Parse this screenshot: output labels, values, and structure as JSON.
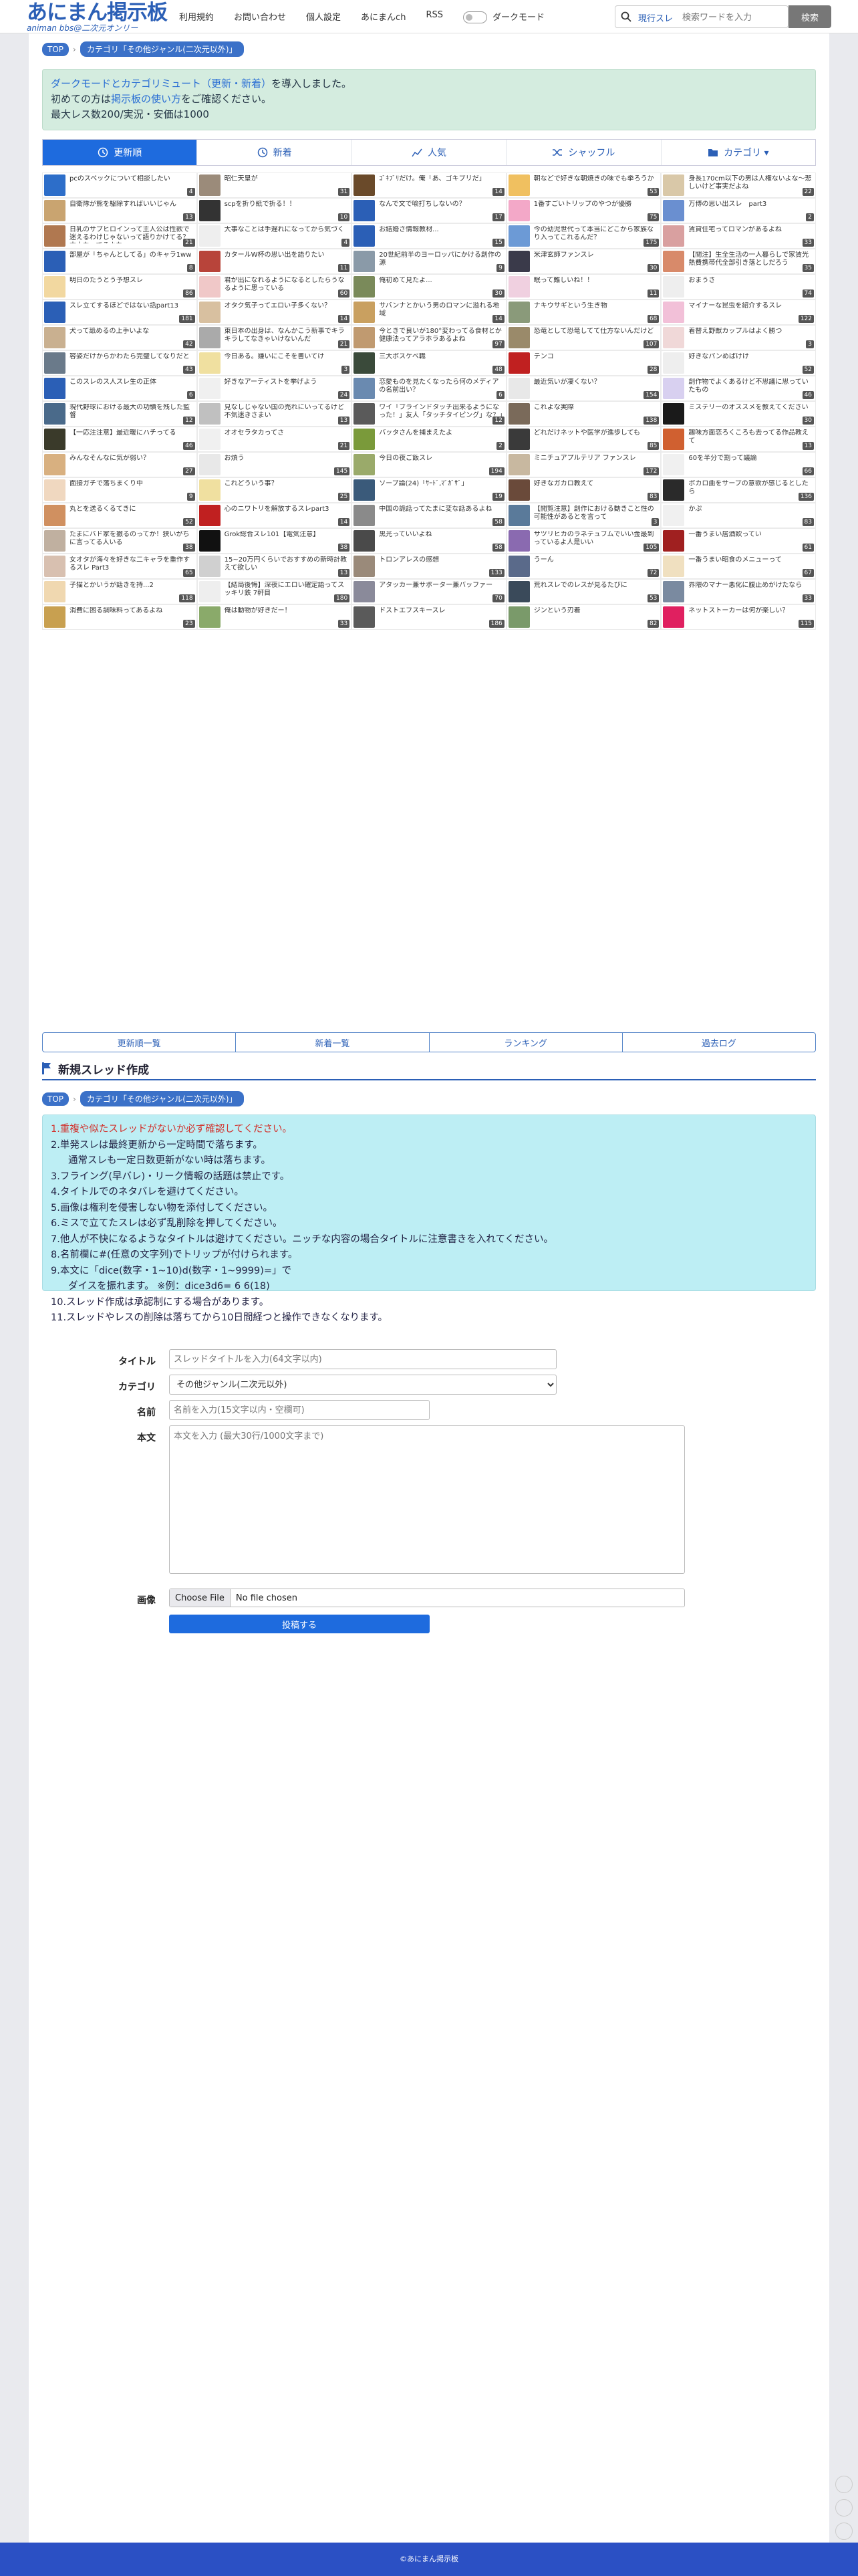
{
  "header": {
    "title": "あにまん掲示板",
    "subtitle": "animan bbs@二次元オンリー",
    "nav": [
      "利用規約",
      "お問い合わせ",
      "個人設定",
      "あにまんch",
      "RSS"
    ],
    "dark_mode_label": "ダークモード",
    "search_scope": "現行スレ",
    "search_placeholder": "検索ワードを入力",
    "search_button": "検索"
  },
  "breadcrumb": {
    "top": "TOP",
    "category": "カテゴリ「その他ジャンル(二次元以外)」"
  },
  "notice": {
    "line1a": "ダークモードとカテゴリミュート（更新・新着）",
    "line1b": "を導入しました。",
    "line2a": "初めての方は",
    "line2b": "掲示板の使い方",
    "line2c": "をご確認ください。",
    "line3": "最大レス数200/実況・安価は1000"
  },
  "tabs": [
    {
      "label": "更新順",
      "icon": "clock-icon"
    },
    {
      "label": "新着",
      "icon": "clock-icon"
    },
    {
      "label": "人気",
      "icon": "chart-icon"
    },
    {
      "label": "シャッフル",
      "icon": "shuffle-icon"
    },
    {
      "label": "カテゴリ ▾",
      "icon": "folder-icon"
    }
  ],
  "threads": [
    {
      "t": "pcのスペックについて相談したい",
      "c": "4",
      "col": "#2d6ec9"
    },
    {
      "t": "昭仁天皇が",
      "c": "31",
      "col": "#9b8b7a"
    },
    {
      "t": "ｺﾞｷﾌﾞﾘだけ。俺「あ、ゴキブリだ」",
      "c": "14",
      "col": "#6a4a2a"
    },
    {
      "t": "朝などで好きな朝焼きの味でも挙ろうか",
      "c": "53",
      "col": "#f0c060"
    },
    {
      "t": "身長170cm以下の男は人権ないよな～悲しいけど事実だよね",
      "c": "22",
      "col": "#d9c8a8"
    },
    {
      "t": "自衛隊が熊を駆除すればいいじゃん",
      "c": "13",
      "col": "#c9a470"
    },
    {
      "t": "scpを折り紙で折る！！",
      "c": "10",
      "col": "#333"
    },
    {
      "t": "なんで文で喩打ちしないの？",
      "c": "17",
      "col": "#2b5fb6"
    },
    {
      "t": "1番すごいトリップのやつが優勝",
      "c": "75",
      "col": "#f3a8c8"
    },
    {
      "t": "万博の思い出スレ　part3",
      "c": "2",
      "col": "#6a8fd0"
    },
    {
      "t": "日乳のサブヒロインって主人公は性欲で迷えるわけじゃないって語りかけてる？本人なってるよな",
      "c": "21",
      "col": "#b07850"
    },
    {
      "t": "大事なことは手遅れになってから気づく",
      "c": "4",
      "col": "#eee"
    },
    {
      "t": "お結婚さ情報教材...",
      "c": "15",
      "col": "#2b5fb6"
    },
    {
      "t": "今の幼児世代って本当にどこから家族なり入ってこれるんだ？",
      "c": "175",
      "col": "#6c9ad6"
    },
    {
      "t": "賃貸住宅ってロマンがあるよね",
      "c": "33",
      "col": "#d9a0a0"
    },
    {
      "t": "部屋が「ちゃんとしてる」のキャラ1ww",
      "c": "8",
      "col": "#2b5fb6"
    },
    {
      "t": "カタールW杯の思い出を語りたい",
      "c": "11",
      "col": "#b8443a"
    },
    {
      "t": "20世紀前半のヨーロッパにかける創作の源",
      "c": "9",
      "col": "#8a9aa8"
    },
    {
      "t": "米津玄師ファンスレ",
      "c": "30",
      "col": "#3a3a4a"
    },
    {
      "t": "【閲注】生全生活の一人暮らしで家賃光熱費携帯代全部引き落としだろう",
      "c": "35",
      "col": "#d88a6a"
    },
    {
      "t": "明日のたうとう予想スレ",
      "c": "86",
      "col": "#f2d8a0"
    },
    {
      "t": "君が出になれるようになるとしたらうなるように思っている",
      "c": "60",
      "col": "#f0c8c8"
    },
    {
      "t": "俺初めて見たよ...",
      "c": "30",
      "col": "#7a8a5a"
    },
    {
      "t": "眠って難しいね！！",
      "c": "11",
      "col": "#f0d0e0"
    },
    {
      "t": "おまうさ",
      "c": "74",
      "col": "#eee"
    },
    {
      "t": "スレ立てするほどではない話part13",
      "c": "181",
      "col": "#2b5fb6"
    },
    {
      "t": "オタク気子ってエロい子多くない？",
      "c": "14",
      "col": "#d8c0a0"
    },
    {
      "t": "サバンナとかいう男のロマンに溢れる地域",
      "c": "14",
      "col": "#c9a060"
    },
    {
      "t": "ナキウサギという生き物",
      "c": "68",
      "col": "#8a9a7a"
    },
    {
      "t": "マイナーな昆虫を紹介するスレ",
      "c": "122",
      "col": "#f2c0d8"
    },
    {
      "t": "犬って舐めるの上手いよな",
      "c": "42",
      "col": "#c9b090"
    },
    {
      "t": "東日本の出身は、なんかこう新事でキラキラしてなきゃいけないんだ",
      "c": "21",
      "col": "#aaa"
    },
    {
      "t": "今ときで良いが180°変わってる食材とか健康法ってアラホラあるよね",
      "c": "97",
      "col": "#c09a70"
    },
    {
      "t": "恐竜として恐竜してて仕方ないんだけど",
      "c": "107",
      "col": "#9a8a6a"
    },
    {
      "t": "着替え野獣カップルはよく勝つ",
      "c": "3",
      "col": "#f0d8d8"
    },
    {
      "t": "容姿だけからかわたら完璧してなりだと",
      "c": "43",
      "col": "#6a7a8a"
    },
    {
      "t": "今日ある。嫌いにこそを書いてけ",
      "c": "3",
      "col": "#f0e0a0"
    },
    {
      "t": "三大ボスケベ職",
      "c": "48",
      "col": "#3a4a3a"
    },
    {
      "t": "テンコ",
      "c": "28",
      "col": "#c02020"
    },
    {
      "t": "好きなパンめばけけ",
      "c": "52",
      "col": "#eee"
    },
    {
      "t": "このスレのス人スレ生の正体",
      "c": "6",
      "col": "#2b5fb6"
    },
    {
      "t": "好きなアーティストを挙げよう",
      "c": "24",
      "col": "#f0f0f0"
    },
    {
      "t": "恋愛ものを見たくなったら何のメディアの名前出い？",
      "c": "6",
      "col": "#6a8ab0"
    },
    {
      "t": "最近気いが凄くない？",
      "c": "154",
      "col": "#e8e8e8"
    },
    {
      "t": "創作物でよくあるけど不思議に思っていたもの",
      "c": "46",
      "col": "#d8d0f0"
    },
    {
      "t": "現代野球における最大の功績を残した監督",
      "c": "12",
      "col": "#4a6a8a"
    },
    {
      "t": "見なしじゃない国の売れにいってるけど不気迷きさまい",
      "c": "13",
      "col": "#c0c0c0"
    },
    {
      "t": "ワイ「ブラインドタッチ出来るようになった！」友人「タッチタイピング」な？」",
      "c": "12",
      "col": "#5a5a5a"
    },
    {
      "t": "これよな実際",
      "c": "138",
      "col": "#7a6a5a"
    },
    {
      "t": "ミステリーのオススメを教えてください",
      "c": "30",
      "col": "#1a1a1a"
    },
    {
      "t": "【一応注注意】最近暖にハチってる",
      "c": "46",
      "col": "#3a3a2a"
    },
    {
      "t": "オオセラタカってさ",
      "c": "21",
      "col": "#f0f0f0"
    },
    {
      "t": "バッタさんを捕まえたよ",
      "c": "2",
      "col": "#7a9a3a"
    },
    {
      "t": "どれだけネットや医学が進歩しても",
      "c": "85",
      "col": "#3a3a3a"
    },
    {
      "t": "趣味方面恋ろくころも去ってる作品教えて",
      "c": "13",
      "col": "#d06030"
    },
    {
      "t": "みんなそんなに気が弱い？",
      "c": "27",
      "col": "#d8b080"
    },
    {
      "t": "お煩う",
      "c": "145",
      "col": "#e8e8e8"
    },
    {
      "t": "今日の夜ご飯スレ",
      "c": "194",
      "col": "#9aaa6a"
    },
    {
      "t": "ミニチュアプルテリア ファンスレ",
      "c": "172",
      "col": "#c8b8a0"
    },
    {
      "t": "60を半分で割って議論",
      "c": "66",
      "col": "#f0f0f0"
    },
    {
      "t": "面接ガチで落ちまくり中",
      "c": "9",
      "col": "#f0d8c0"
    },
    {
      "t": "これどういう事？",
      "c": "25",
      "col": "#f0e0a0"
    },
    {
      "t": "ソーブ論(24)「ｻｰﾄﾞ,ﾏﾞｶﾞｻﾞ」",
      "c": "19",
      "col": "#3a5a7a"
    },
    {
      "t": "好きなガカロ教えて",
      "c": "83",
      "col": "#6a4a3a"
    },
    {
      "t": "ボカロ曲をサーブの意欲が感じるとしたら",
      "c": "136",
      "col": "#2a2a2a"
    },
    {
      "t": "丸とを送るくるてきに",
      "c": "52",
      "col": "#d09060"
    },
    {
      "t": "心のニワトリを解放するスレpart3",
      "c": "14",
      "col": "#c02020"
    },
    {
      "t": "中国の詭話ってたまに変な話あるよね",
      "c": "58",
      "col": "#8a8a8a"
    },
    {
      "t": "【閲覧注意】創作における動きこと性の可能性があるとを言って",
      "c": "3",
      "col": "#5a7a9a"
    },
    {
      "t": "かぷ",
      "c": "83",
      "col": "#f0f0f0"
    },
    {
      "t": "たまにバド家を撤るのってか！狭いがちに言ってる人いる",
      "c": "38",
      "col": "#c0b0a0"
    },
    {
      "t": "Grok総合スレ101【電気注意】",
      "c": "38",
      "col": "#111"
    },
    {
      "t": "黒光っていいよね",
      "c": "58",
      "col": "#4a4a4a"
    },
    {
      "t": "サツリヒカのラネテュフムでいい金最到っているよ人是いい",
      "c": "105",
      "col": "#8a6ab0"
    },
    {
      "t": "一番うまい居酒飲ってい",
      "c": "61",
      "col": "#a02020"
    },
    {
      "t": "女オタが海々を好きな二キャラを重作するスレ Part3",
      "c": "65",
      "col": "#d8c0b0"
    },
    {
      "t": "15~20万円くらいでおすすめの新時計教えて欲しい",
      "c": "13",
      "col": "#d0d0d0"
    },
    {
      "t": "トロンアレスの感想",
      "c": "133",
      "col": "#9a8a7a"
    },
    {
      "t": "うーん",
      "c": "72",
      "col": "#5a6a8a"
    },
    {
      "t": "一番うまい昭食のメニューって",
      "c": "67",
      "col": "#f0e0c0"
    },
    {
      "t": "子猫とかいうが話きを持...2",
      "c": "118",
      "col": "#f0d8b0"
    },
    {
      "t": "【結局後悔】深夜にエロい確定語ってスッキリ鉄 7軒目",
      "c": "180",
      "col": "#eee"
    },
    {
      "t": "アタッカー兼サポーター兼バッファー",
      "c": "70",
      "col": "#8a8a9a"
    },
    {
      "t": "荒れスレでのレスが見るたびに",
      "c": "53",
      "col": "#3a4a5a"
    },
    {
      "t": "界隈のマナー悪化に腹止めがけたなら",
      "c": "33",
      "col": "#7a8aa0"
    },
    {
      "t": "消費に困る調味料ってあるよね",
      "c": "23",
      "col": "#c8a050"
    },
    {
      "t": "俺は動物が好きだー！",
      "c": "33",
      "col": "#8aaa6a"
    },
    {
      "t": "ドストエフスキースレ",
      "c": "186",
      "col": "#5a5a5a"
    },
    {
      "t": "ジンという刃着",
      "c": "82",
      "col": "#7a9a6a"
    },
    {
      "t": "ネットストーカーは何が楽しい？",
      "c": "115",
      "col": "#e02060"
    }
  ],
  "subnav": [
    "更新順一覧",
    "新着一覧",
    "ランキング",
    "過去ログ"
  ],
  "new_thread": {
    "title": "新規スレッド作成",
    "rules": [
      "1.重複や似たスレッドがないか必ず確認してください。",
      "2.単発スレは最終更新から一定時間で落ちます。",
      "通常スレも一定日数更新がない時は落ちます。",
      "3.フライング(早バレ)・リーク情報の話題は禁止です。",
      "4.タイトルでのネタバレを避けてください。",
      "5.画像は権利を侵害しない物を添付してください。",
      "6.ミスで立てたスレは必ず乱削除を押してください。",
      "7.他人が不快になるようなタイトルは避けてください。ニッチな内容の場合タイトルに注意書きを入れてください。",
      "8.名前欄に#(任意の文字列)でトリップが付けられます。",
      "9.本文に「dice(数字・1~10)d(数字・1~9999)=」で",
      "ダイスを振れます。 ※例：dice3d6= 6 6(18)",
      "10.スレッド作成は承認制にする場合があります。",
      "11.スレッドやレスの削除は落ちてから10日間経つと操作できなくなります。"
    ],
    "labels": {
      "title": "タイトル",
      "category": "カテゴリ",
      "name": "名前",
      "body": "本文",
      "image": "画像"
    },
    "placeholders": {
      "title": "スレッドタイトルを入力(64文字以内)",
      "name": "名前を入力(15文字以内・空欄可)",
      "body": "本文を入力 (最大30行/1000文字まで)"
    },
    "category_value": "その他ジャンル(二次元以外)",
    "file_button": "Choose File",
    "file_name": "No file chosen",
    "submit": "投稿する"
  },
  "footer": "©あにまん掲示板"
}
